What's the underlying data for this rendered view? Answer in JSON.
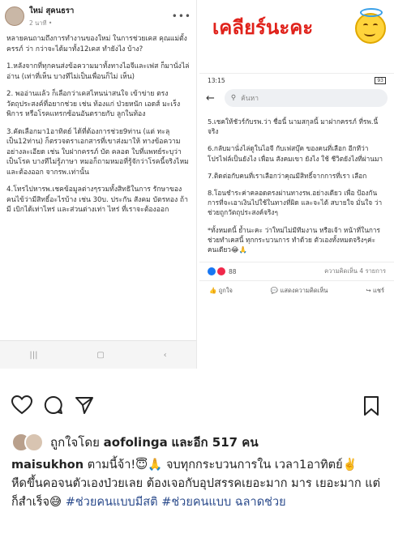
{
  "left_post": {
    "author": "ใหม่ สุคนธรา",
    "time": "2 นาที •",
    "paragraphs": [
      "หลายคนถามถึงการทำงานของใหม่ ในการช่วยเคส คุณแม่ตั้งครรภ์ ว่า กว่าจะได้มาทั้ง12เคส ทำยังไง บ้าง?",
      "1.หลังจากที่ทุกคนส่งข้อความมาทั้งทางไอจีและเฟส ก็มานั่งไล่อ่าน (เท่าที่เห็น บางทีไม่เป็นเพื่อนก็ไม่ เห็น)",
      "2. พออ่านแล้ว ก็เลือกว่าเคสไหนน่าสนใจ เข้าข่าย ตรงวัตถุประสงค์ที่อยากช่วย เช่น ท้องแก่ ป่วยหนัก เอดส์ มะเร็ง พิการ หรือโรคแทรกซ้อนอันตรายกับ ลูกในท้อง",
      "3.คัดเลือกมา1อาทิตย์ ได้ที่ต้องการช่วย9ท่าน (แต่ ทะลุเป็น12ท่าน) ก็ตรวจตราเอกสารที่เขาส่งมาให้ ทางข้อความอย่างละเอียด เช่น ใบฝากครรภ์ บัต คลอด ใบที่แพทย์ระบุว่าเป็นโรค บางทีไม่รู้ภาษา หมอก็ถามหมอที่รู้จักว่าโรคนี้จริงไหม และต้องออก จากรพ.เท่านั้น",
      "4.โทรไปหารพ.เชคข้อมูลต่างๆรวมทั้งสิทธิในการ รักษาของคนไข้ว่ามีสิทธิ์อะไรบ้าง เช่น 30บ. ประกัน สังคม บัตรทอง ถ้ามี เบิกได้เท่าไหร่ และส่วนต่างเท่า ไหร่ ที่เราจะต้องออก"
    ]
  },
  "banner": {
    "text": "เคลียร์นะคะ"
  },
  "right_post": {
    "time": "13:15",
    "battery": "93",
    "search_placeholder": "ค้นหา",
    "paragraphs": [
      "5.เชคให้ชัวร์กับรพ.ว่า ชื่อนี้ นามสกุลนี้ มาฝากครรภ์ ที่รพ.นี้จริง",
      "6.กลับมานั่งไล่ดูในไอจี กับเฟสบุ๊ค ของคนที่เลือก อีกทีว่าโปรไฟล์เป็นยังไง เพื่อน สังคมเขา ยังไง ใช้ ชีวิตยังไงที่ผ่านมา",
      "7.ติดต่อกับคนที่เราเลือกว่าคุณมีสิทธิ์จากการที่เรา เลือก",
      "8.โอนชำระค่าคลอดตรงผ่านทางรพ.อย่างเดียว เพื่อ ป้องกันการที่จะเอาเงินไปใช้ในทางที่ผิด และจะได้ สบายใจ มั่นใจ ว่าช่วยถูกวัตถุประสงค์จริงๆ",
      "*ทั้งหมดนี้ ย้ำนะคะ ว่าใหม่ไม่มีทีมงาน หรือเจ้า หน้าที่ในการช่วยทำเคสนี้ ทุกกระบวนการ ทำด้วย ตัวเองทั้งหมดจริงๆค่ะ คนเดียว😂🙏"
    ],
    "reaction_count": "88",
    "comment_count": "ความคิดเห็น 4 รายการ",
    "like_label": "ถูกใจ",
    "comment_label": "แสดงความคิดเห็น",
    "share_label": "แชร์"
  },
  "instagram": {
    "liked_by_prefix": "ถูกใจโดย",
    "liked_by_user": "aofolinga",
    "liked_by_suffix": "และอีก 517 คน",
    "caption_user": "maisukhon",
    "caption_line1": "ตามนี้จ้า!😇🙏 จบทุกกระบวนการใน เวลา1อาทิตย์✌️",
    "caption_line2": "หืดขึ้นคอจนตัวเองป่วยเลย ต้องเจอกับอุปสรรคเยอะมาก มาร เยอะมาก แต่ก็สำเร็จ😅",
    "hashtag1": "#ช่วยคนแบบมีสติ",
    "hashtag2": "#ช่วยคนแบบ ฉลาดช่วย"
  }
}
